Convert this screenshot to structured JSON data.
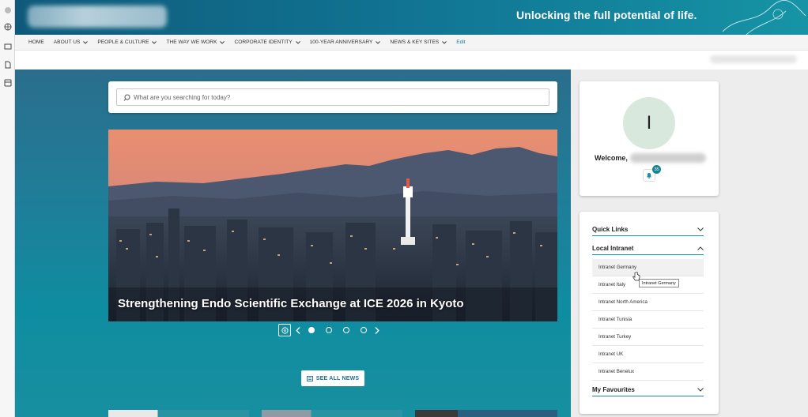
{
  "banner": {
    "tagline": "Unlocking the full potential of life."
  },
  "nav": {
    "items": [
      "HOME",
      "ABOUT US",
      "PEOPLE & CULTURE",
      "THE WAY WE WORK",
      "CORPORATE IDENTITY",
      "100-YEAR ANNIVERSARY",
      "NEWS & KEY SITES"
    ],
    "edit": "Edit"
  },
  "search": {
    "placeholder": "What are you searching for today?"
  },
  "hero": {
    "caption": "Strengthening Endo Scientific Exchange at ICE 2026 in Kyoto",
    "slides": 4,
    "active_slide": 1
  },
  "news": {
    "see_all": "SEE ALL NEWS"
  },
  "profile": {
    "initial": "I",
    "welcome": "Welcome,",
    "notifications": "35"
  },
  "links": {
    "quick_links": "Quick Links",
    "local_intranet": "Local Intranet",
    "my_favourites": "My Favourites",
    "intranet_items": [
      "Intranet Germany",
      "Intranet Italy",
      "Intranet North America",
      "Intranet Tunisia",
      "Intranet Turkey",
      "Intranet UK",
      "Intranet Benelux"
    ],
    "tooltip": "Intranet Germany"
  },
  "colors": {
    "accent": "#1d8fa0",
    "banner": "#117795",
    "hero_bg": "#1e7f9a"
  }
}
